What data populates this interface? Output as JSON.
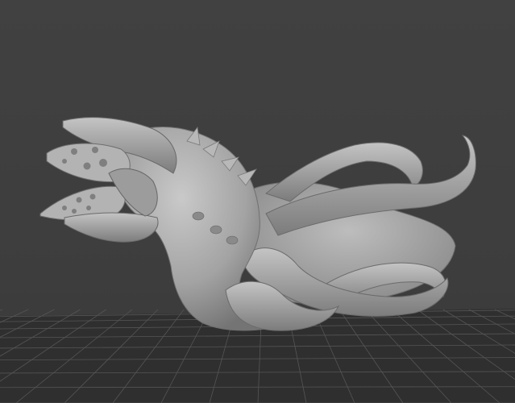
{
  "viewport": {
    "background_color": "#3f3f3f",
    "grid_color": "#2e2e2e",
    "grid_line_color": "#555555",
    "model_color": "#a9a9a9",
    "model": "sculpted-creature-mesh",
    "view": "perspective",
    "ground_grid": true
  }
}
